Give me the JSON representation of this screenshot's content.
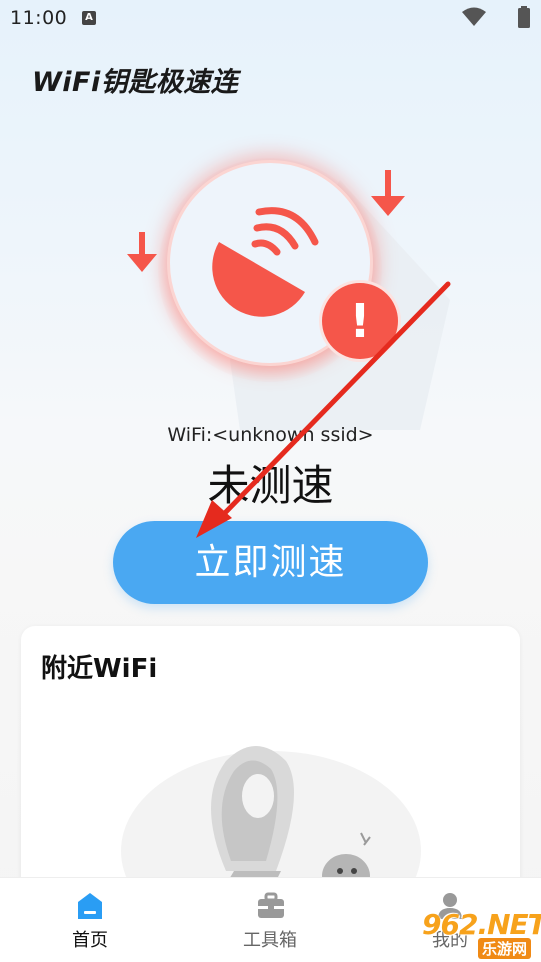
{
  "status_bar": {
    "time": "11:00",
    "notification_badge": "A"
  },
  "app": {
    "title": "WiFi钥匙极速连"
  },
  "hero": {
    "alert_symbol": "!"
  },
  "connection": {
    "ssid_label": "WiFi:<unknown ssid>",
    "speed_status": "未测速"
  },
  "actions": {
    "test_button_label": "立即测速"
  },
  "nearby": {
    "title": "附近WiFi"
  },
  "nav": {
    "items": [
      {
        "label": "首页",
        "icon": "home-icon",
        "active": true
      },
      {
        "label": "工具箱",
        "icon": "toolbox-icon",
        "active": false
      },
      {
        "label": "我的",
        "icon": "profile-icon",
        "active": false
      }
    ]
  },
  "watermark": {
    "brand": "962.NET",
    "site": "乐游网"
  },
  "colors": {
    "accent": "#4aa8f2",
    "alert": "#f5564a",
    "annotation_arrow": "#e52a1e"
  }
}
